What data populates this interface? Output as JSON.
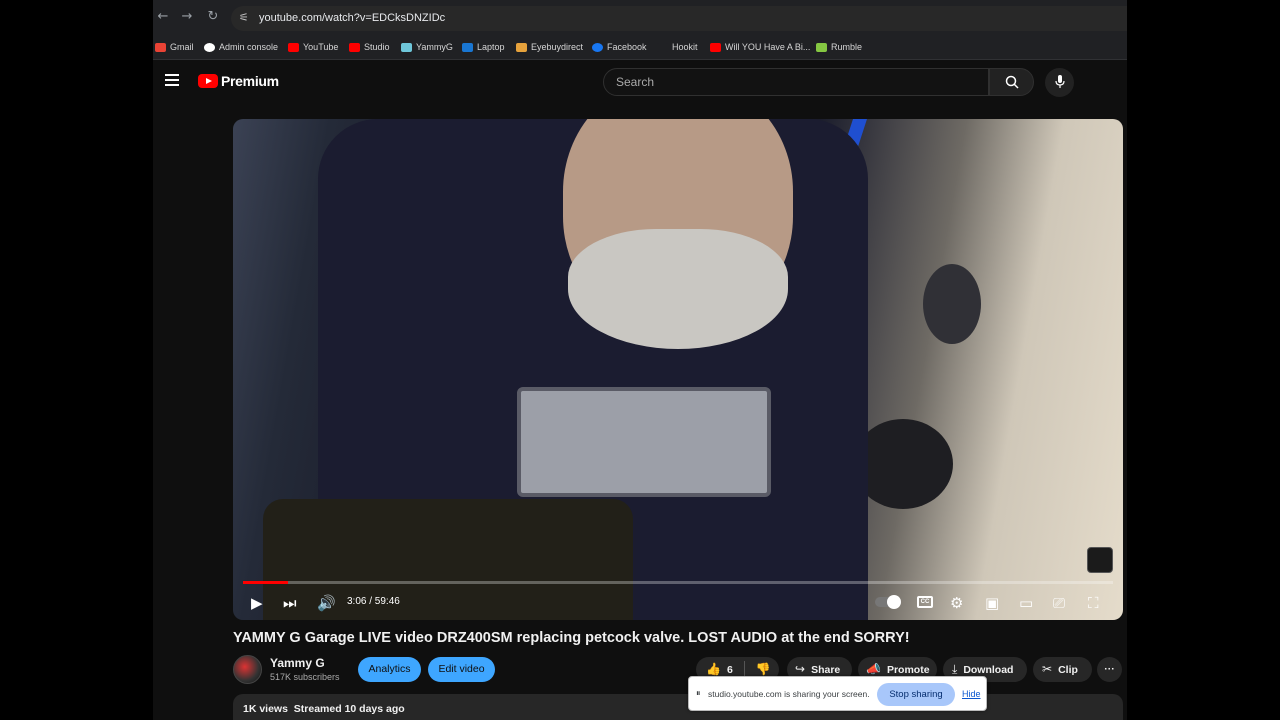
{
  "browser": {
    "url": "youtube.com/watch?v=EDCksDNZIDc",
    "nav": {
      "back": "←",
      "forward": "→",
      "reload": "↻"
    },
    "bookmarks": [
      {
        "label": "Gmail",
        "icon": "gmail-icon",
        "color": "#ea4335"
      },
      {
        "label": "Admin console",
        "icon": "google-icon",
        "color": "#4285f4"
      },
      {
        "label": "YouTube",
        "icon": "youtube-icon",
        "color": "#ff0000"
      },
      {
        "label": "Studio",
        "icon": "youtube-studio-icon",
        "color": "#ff0000"
      },
      {
        "label": "YammyG",
        "icon": "yammyg-icon",
        "color": "#6ec6d9"
      },
      {
        "label": "Laptop",
        "icon": "dell-icon",
        "color": "#1976d2"
      },
      {
        "label": "Eyebuydirect",
        "icon": "glasses-icon",
        "color": "#e6a23c"
      },
      {
        "label": "Facebook",
        "icon": "facebook-icon",
        "color": "#1877f2"
      },
      {
        "label": "Hookit",
        "icon": "hookit-icon",
        "color": "#202124"
      },
      {
        "label": "Will YOU Have A Bi...",
        "icon": "youtube-icon",
        "color": "#ff0000"
      },
      {
        "label": "Rumble",
        "icon": "rumble-icon",
        "color": "#85c742"
      }
    ]
  },
  "header": {
    "logo_text": "Premium",
    "search_placeholder": "Search",
    "search_icon": "search-icon",
    "mic_icon": "microphone-icon"
  },
  "player": {
    "time": "3:06 / 59:46",
    "progress": 0.052,
    "controls": {
      "play": "▶",
      "next": "⏭",
      "volume": "🔊",
      "settings": "⚙",
      "miniplayer": "▣",
      "theater": "▭",
      "cast": "⎚",
      "fullscreen": "⛶"
    },
    "cc_label": "CC"
  },
  "video": {
    "title": "YAMMY G Garage LIVE video DRZ400SM replacing petcock valve. LOST AUDIO at the end SORRY!",
    "channel": "Yammy G",
    "subscribers": "517K subscribers",
    "analytics_label": "Analytics",
    "edit_label": "Edit video",
    "likes": "6",
    "share_label": "Share",
    "promote_label": "Promote",
    "download_label": "Download",
    "clip_label": "Clip",
    "more": "···",
    "views": "1K views",
    "streamed": "Streamed 10 days ago"
  },
  "share_bar": {
    "message": "studio.youtube.com is sharing your screen.",
    "stop_label": "Stop sharing",
    "hide_label": "Hide"
  }
}
